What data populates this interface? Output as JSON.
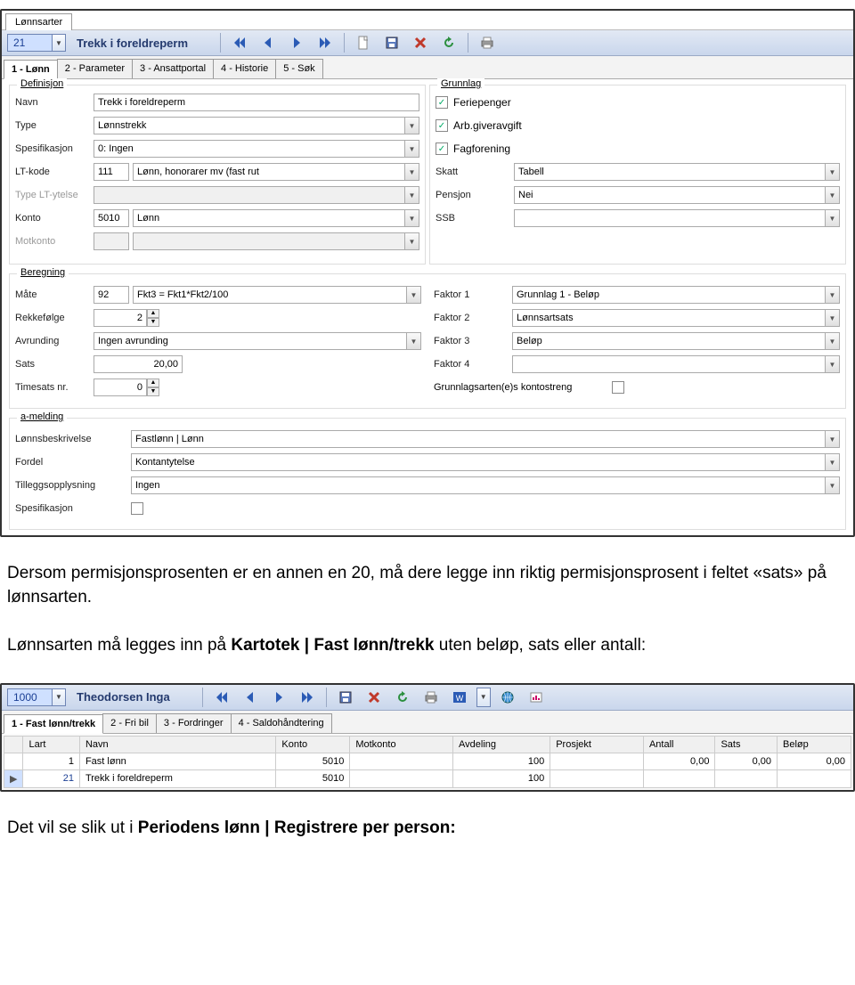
{
  "screenshot1": {
    "window_tab": "Lønnsarter",
    "toolbar": {
      "id_value": "21",
      "name": "Trekk i foreldreperm"
    },
    "subtabs": [
      "1 - Lønn",
      "2 - Parameter",
      "3 - Ansattportal",
      "4 - Historie",
      "5 - Søk"
    ],
    "definisjon": {
      "legend": "Definisjon",
      "navn_label": "Navn",
      "navn_value": "Trekk i foreldreperm",
      "type_label": "Type",
      "type_value": "Lønnstrekk",
      "spesifikasjon_label": "Spesifikasjon",
      "spesifikasjon_value": "0: Ingen",
      "ltkode_label": "LT-kode",
      "ltkode_code": "111",
      "ltkode_value": "Lønn, honorarer mv (fast rut",
      "type_lt_label": "Type LT-ytelse",
      "konto_label": "Konto",
      "konto_code": "5010",
      "konto_value": "Lønn",
      "motkonto_label": "Motkonto"
    },
    "grunnlag": {
      "legend": "Grunnlag",
      "feriepenger_label": "Feriepenger",
      "arbgiver_label": "Arb.giveravgift",
      "fagforening_label": "Fagforening",
      "skatt_label": "Skatt",
      "skatt_value": "Tabell",
      "pensjon_label": "Pensjon",
      "pensjon_value": "Nei",
      "ssb_label": "SSB",
      "ssb_value": ""
    },
    "beregning": {
      "legend": "Beregning",
      "mate_label": "Måte",
      "mate_code": "92",
      "mate_value": "Fkt3 = Fkt1*Fkt2/100",
      "rekke_label": "Rekkefølge",
      "rekke_value": "2",
      "avrunding_label": "Avrunding",
      "avrunding_value": "Ingen avrunding",
      "sats_label": "Sats",
      "sats_value": "20,00",
      "timesats_label": "Timesats nr.",
      "timesats_value": "0",
      "faktor1_label": "Faktor 1",
      "faktor1_value": "Grunnlag 1 - Beløp",
      "faktor2_label": "Faktor 2",
      "faktor2_value": "Lønnsartsats",
      "faktor3_label": "Faktor 3",
      "faktor3_value": "Beløp",
      "faktor4_label": "Faktor 4",
      "faktor4_value": "",
      "kontostreng_label": "Grunnlagsarten(e)s kontostreng"
    },
    "amelding": {
      "legend": "a-melding",
      "lonnsbesk_label": "Lønnsbeskrivelse",
      "lonnsbesk_value": "Fastlønn | Lønn",
      "fordel_label": "Fordel",
      "fordel_value": "Kontantytelse",
      "tillegg_label": "Tilleggsopplysning",
      "tillegg_value": "Ingen",
      "spes_label": "Spesifikasjon"
    }
  },
  "para1": "Dersom permisjonsprosenten er en annen en 20, må dere legge inn riktig permisjonsprosent i feltet «sats» på lønnsarten.",
  "para2_pre": "Lønnsarten må legges inn på ",
  "para2_bold": "Kartotek | Fast lønn/trekk",
  "para2_post": " uten beløp, sats eller antall:",
  "screenshot2": {
    "toolbar": {
      "id_value": "1000",
      "name": "Theodorsen Inga"
    },
    "subtabs": [
      "1 - Fast lønn/trekk",
      "2 - Fri bil",
      "3 - Fordringer",
      "4 - Saldohåndtering"
    ],
    "headers": [
      "Lart",
      "Navn",
      "Konto",
      "Motkonto",
      "Avdeling",
      "Prosjekt",
      "Antall",
      "Sats",
      "Beløp"
    ],
    "rows": [
      {
        "lart": "1",
        "navn": "Fast lønn",
        "konto": "5010",
        "motkonto": "",
        "avdeling": "100",
        "prosjekt": "",
        "antall": "0,00",
        "sats": "0,00",
        "belop": "0,00"
      },
      {
        "lart": "21",
        "navn": "Trekk i foreldreperm",
        "konto": "5010",
        "motkonto": "",
        "avdeling": "100",
        "prosjekt": "",
        "antall": "",
        "sats": "",
        "belop": ""
      }
    ]
  },
  "para3_pre": "Det vil se slik ut i ",
  "para3_bold": "Periodens lønn | Registrere per person:"
}
